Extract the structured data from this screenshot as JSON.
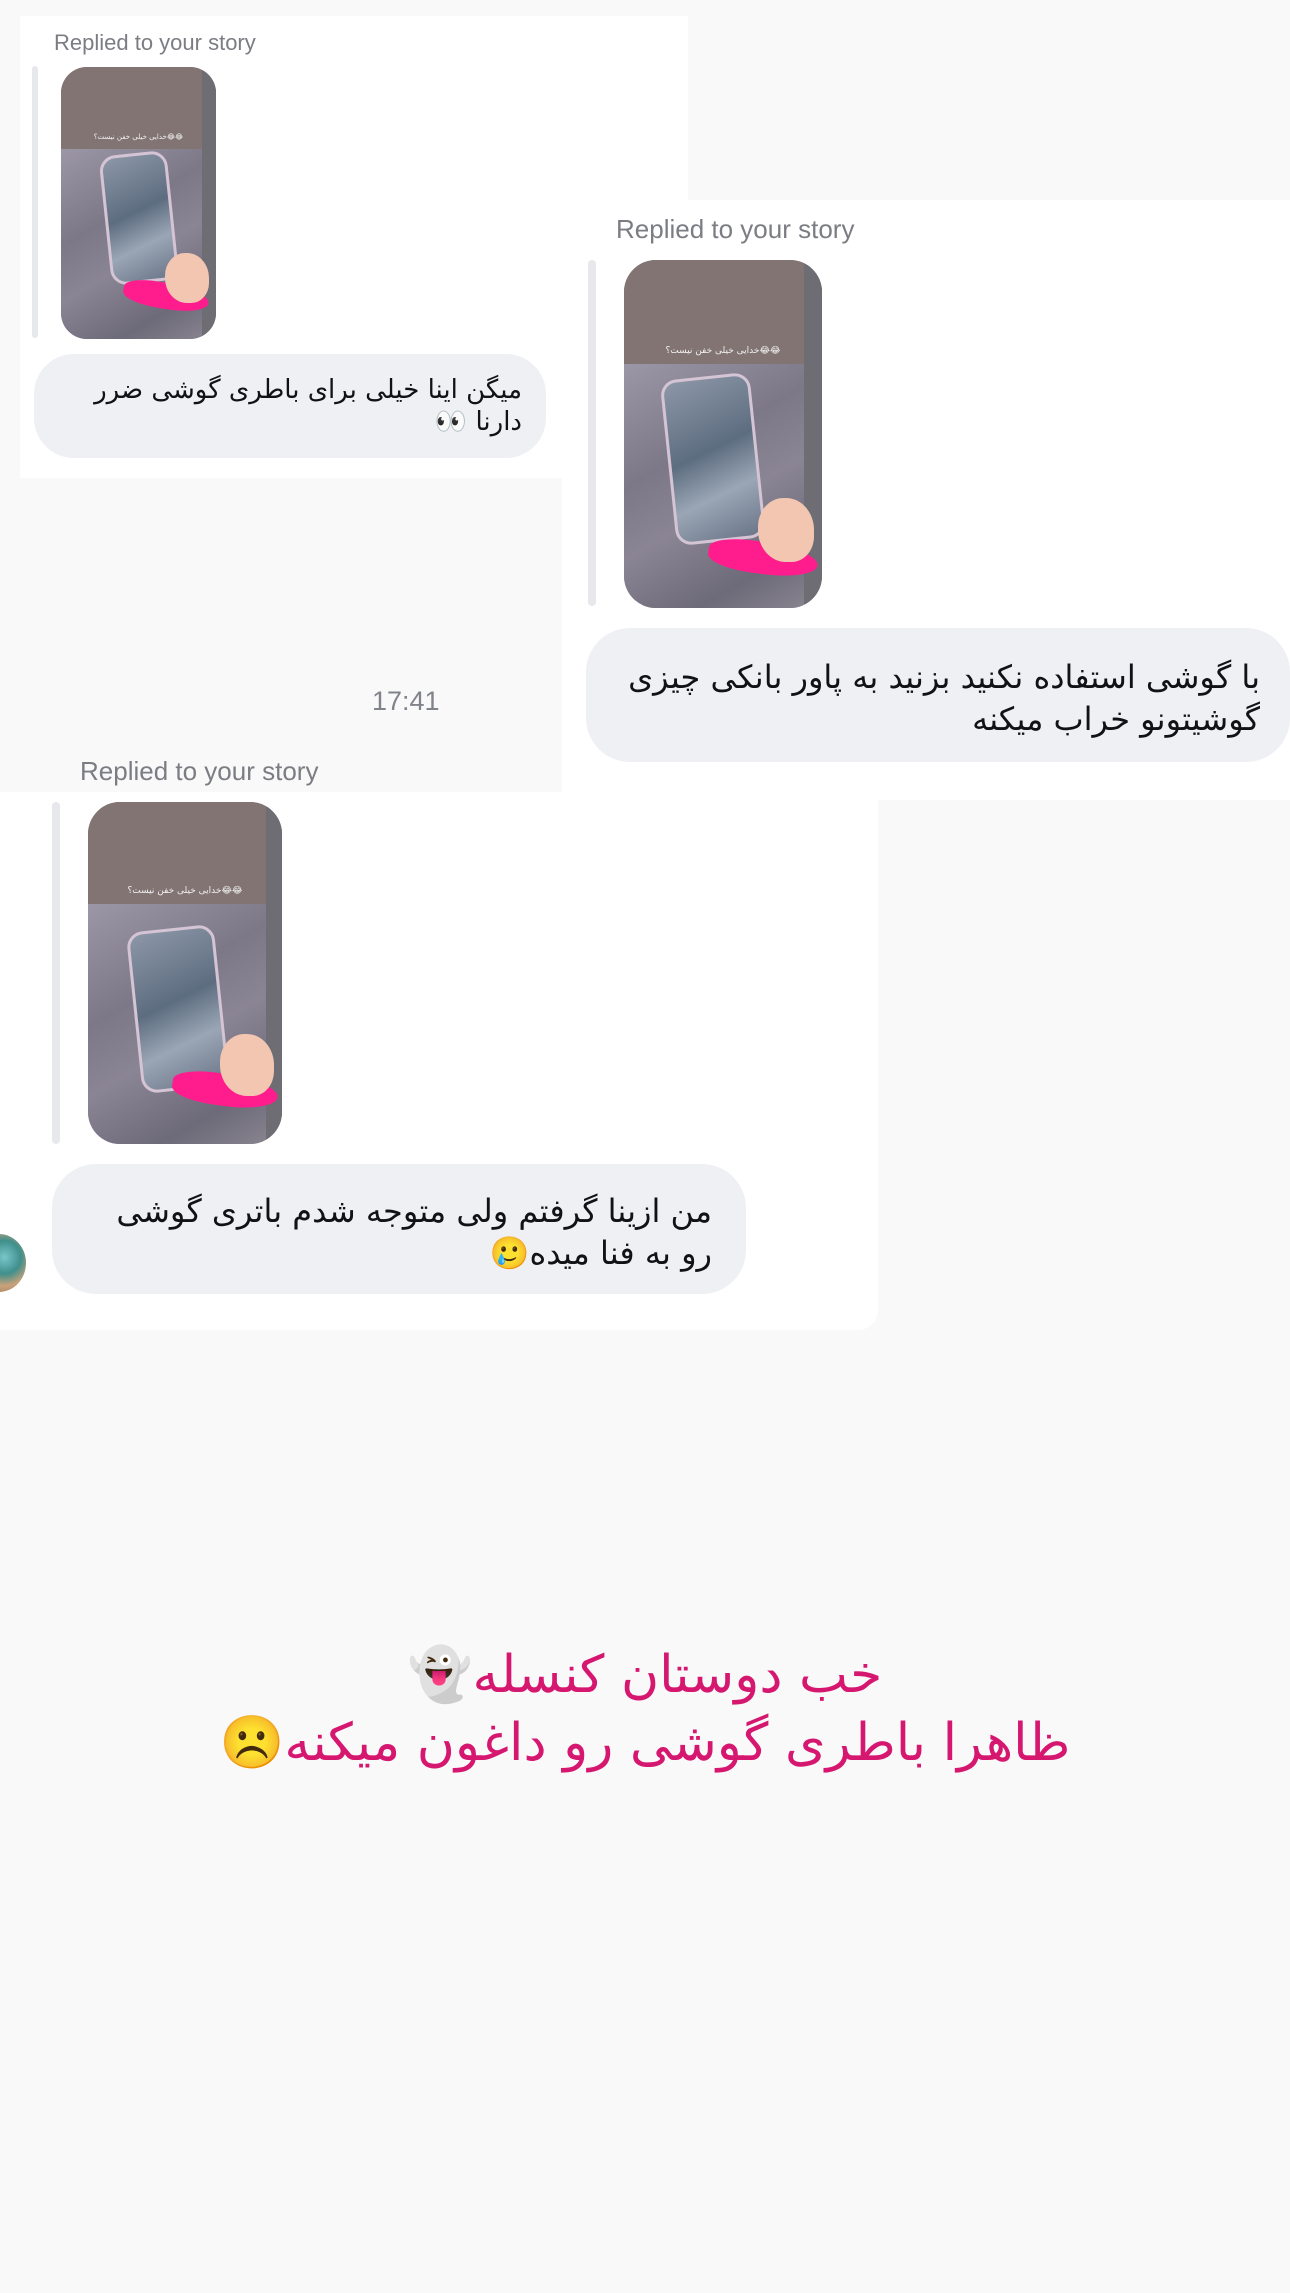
{
  "messages": [
    {
      "replied_label": "Replied to your story",
      "story_caption": "خدایی خیلی خفن نیست؟😂😂",
      "text": "میگن اینا خیلی برای باطری گوشی ضرر دارنا 👀"
    },
    {
      "replied_label": "Replied to your story",
      "story_caption": "خدایی خیلی خفن نیست؟😂😂",
      "text": "با گوشی استفاده نکنید بزنید به پاور بانکی چیزی گوشیتونو خراب میکنه"
    },
    {
      "replied_label": "Replied to your story",
      "story_caption": "خدایی خیلی خفن نیست؟😂😂",
      "text": "من ازینا گرفتم ولی متوجه شدم باتری گوشی رو به فنا میده🥲"
    }
  ],
  "timestamp": "17:41",
  "overlay": {
    "line1": "خب دوستان کنسله👻",
    "line2": "ظاهرا باطری گوشی رو داغون میکنه☹️"
  },
  "colors": {
    "background": "#f9f9f9",
    "bubble": "#eff0f3",
    "overlay_text": "#d61770",
    "label": "#7b7d83"
  }
}
